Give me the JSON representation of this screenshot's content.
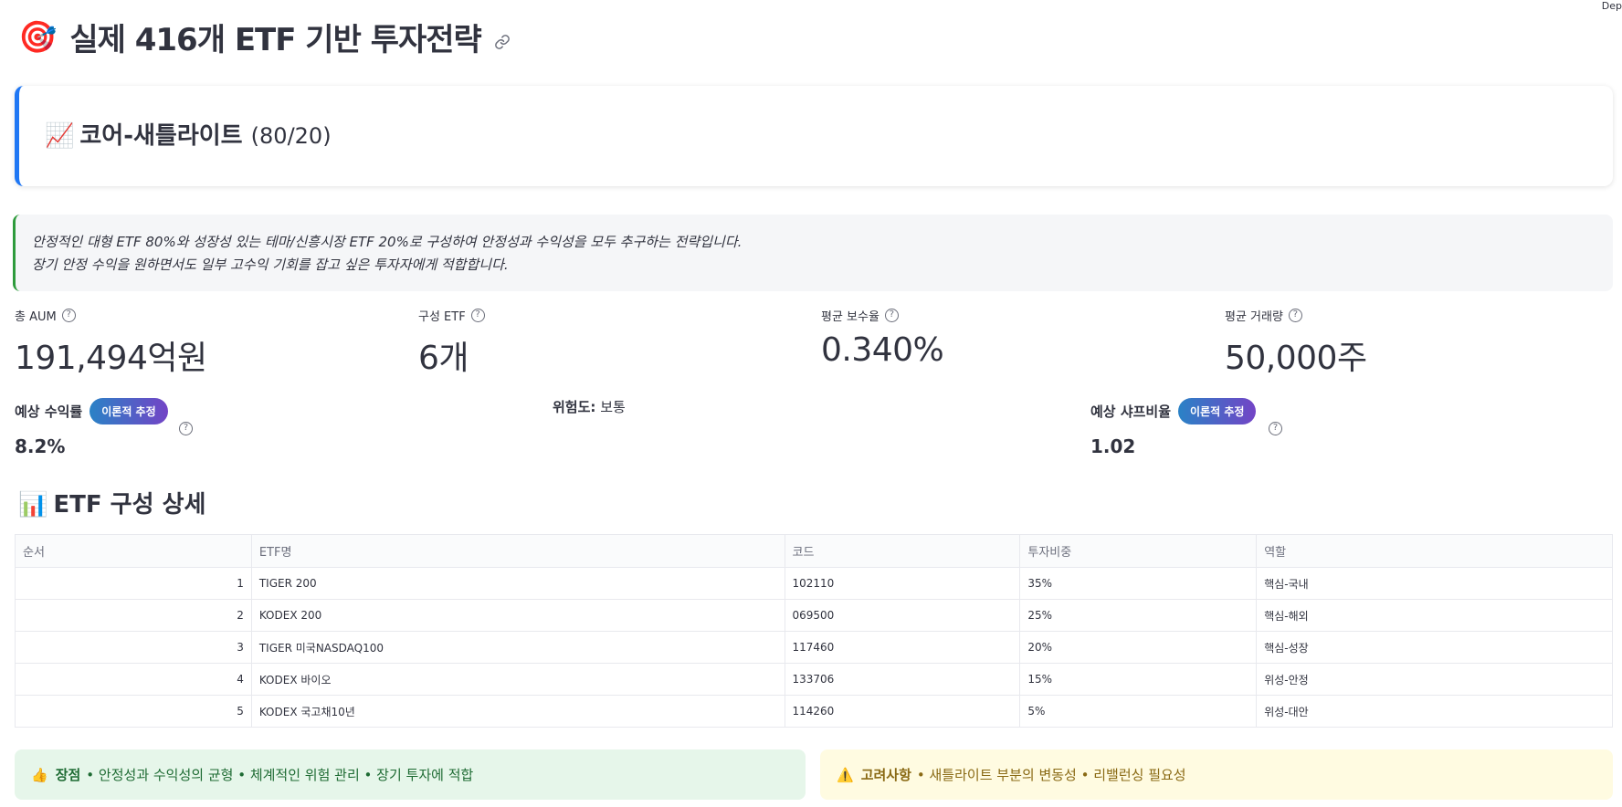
{
  "corner_text": "Dep",
  "page": {
    "title_emoji": "🎯",
    "title": "실제 416개 ETF 기반 투자전략",
    "link_icon": "link-icon"
  },
  "strategy": {
    "emoji": "📈",
    "name": "코어-새틀라이트",
    "ratio": "(80/20)"
  },
  "description": {
    "line1": "안정적인 대형 ETF 80%와 성장성 있는 테마/신흥시장 ETF 20%로 구성하여 안정성과 수익성을 모두 추구하는 전략입니다.",
    "line2": "장기 안정 수익을 원하면서도 일부 고수익 기회를 잡고 싶은 투자자에게 적합합니다."
  },
  "metrics": [
    {
      "label": "총 AUM",
      "value": "191,494억원"
    },
    {
      "label": "구성 ETF",
      "value": "6개"
    },
    {
      "label": "평균 보수율",
      "value": "0.340%"
    },
    {
      "label": "평균 거래량",
      "value": "50,000주"
    }
  ],
  "expected_return": {
    "label": "예상 수익률",
    "badge": "이론적 추정",
    "value": "8.2%"
  },
  "risk": {
    "label": "위험도:",
    "value": "보통"
  },
  "expected_sharpe": {
    "label": "예상 샤프비율",
    "badge": "이론적 추정",
    "value": "1.02"
  },
  "etf_section": {
    "emoji": "📊",
    "title": "ETF 구성 상세"
  },
  "table": {
    "headers": [
      "순서",
      "ETF명",
      "코드",
      "투자비중",
      "역할"
    ],
    "rows": [
      [
        "1",
        "TIGER 200",
        "102110",
        "35%",
        "핵심-국내"
      ],
      [
        "2",
        "KODEX 200",
        "069500",
        "25%",
        "핵심-해외"
      ],
      [
        "3",
        "TIGER 미국NASDAQ100",
        "117460",
        "20%",
        "핵심-성장"
      ],
      [
        "4",
        "KODEX 바이오",
        "133706",
        "15%",
        "위성-안정"
      ],
      [
        "5",
        "KODEX 국고채10년",
        "114260",
        "5%",
        "위성-대안"
      ]
    ]
  },
  "pros": {
    "emoji": "👍",
    "label": "장점",
    "text": "• 안정성과 수익성의 균형 • 체계적인 위험 관리 • 장기 투자에 적합"
  },
  "cons": {
    "emoji": "⚠️",
    "label": "고려사항",
    "text": "• 새틀라이트 부분의 변동성 • 리밸런싱 필요성"
  },
  "colors": {
    "accent_blue": "#1f77f4",
    "accent_green": "#2e9b3c"
  }
}
